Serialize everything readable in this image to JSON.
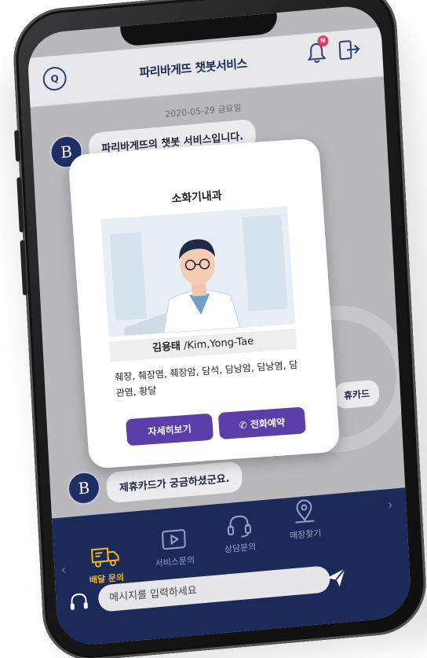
{
  "header": {
    "title": "파리바게뜨 챗봇서비스",
    "notification_badge": "N"
  },
  "chat": {
    "date": "2020-05-29 금요일",
    "avatar_letter": "B",
    "messages": [
      "파리바게뜨의 챗봇 서비스입니다.",
      "제휴카드가 궁금하셨군요."
    ],
    "side_chip_text": "휴카드"
  },
  "modal": {
    "title": "소화기내과",
    "doctor_name": "김용태",
    "doctor_name_en": "/Kim,Yong-Tae",
    "specialties": "췌장, 췌장염, 췌장암, 담석, 담낭암, 담낭염, 담관염, 황달",
    "detail_button": "자세히보기",
    "call_button": "전화예약"
  },
  "bottom_nav": {
    "items": [
      {
        "label": "배달 문의",
        "icon": "delivery-truck-icon",
        "active": true
      },
      {
        "label": "서비스문의",
        "icon": "play-icon",
        "active": false
      },
      {
        "label": "상담문의",
        "icon": "headset-icon",
        "active": false
      },
      {
        "label": "매장찾기",
        "icon": "map-pin-icon",
        "active": false
      }
    ],
    "prev_arrow": "‹",
    "next_arrow": "›"
  },
  "input": {
    "placeholder": "메시지를 입력하세요"
  },
  "colors": {
    "nav_bg": "#1c2a5a",
    "accent_active": "#f0b62a",
    "button_purple": "#5b3fa8",
    "badge_pink": "#e23a66"
  }
}
